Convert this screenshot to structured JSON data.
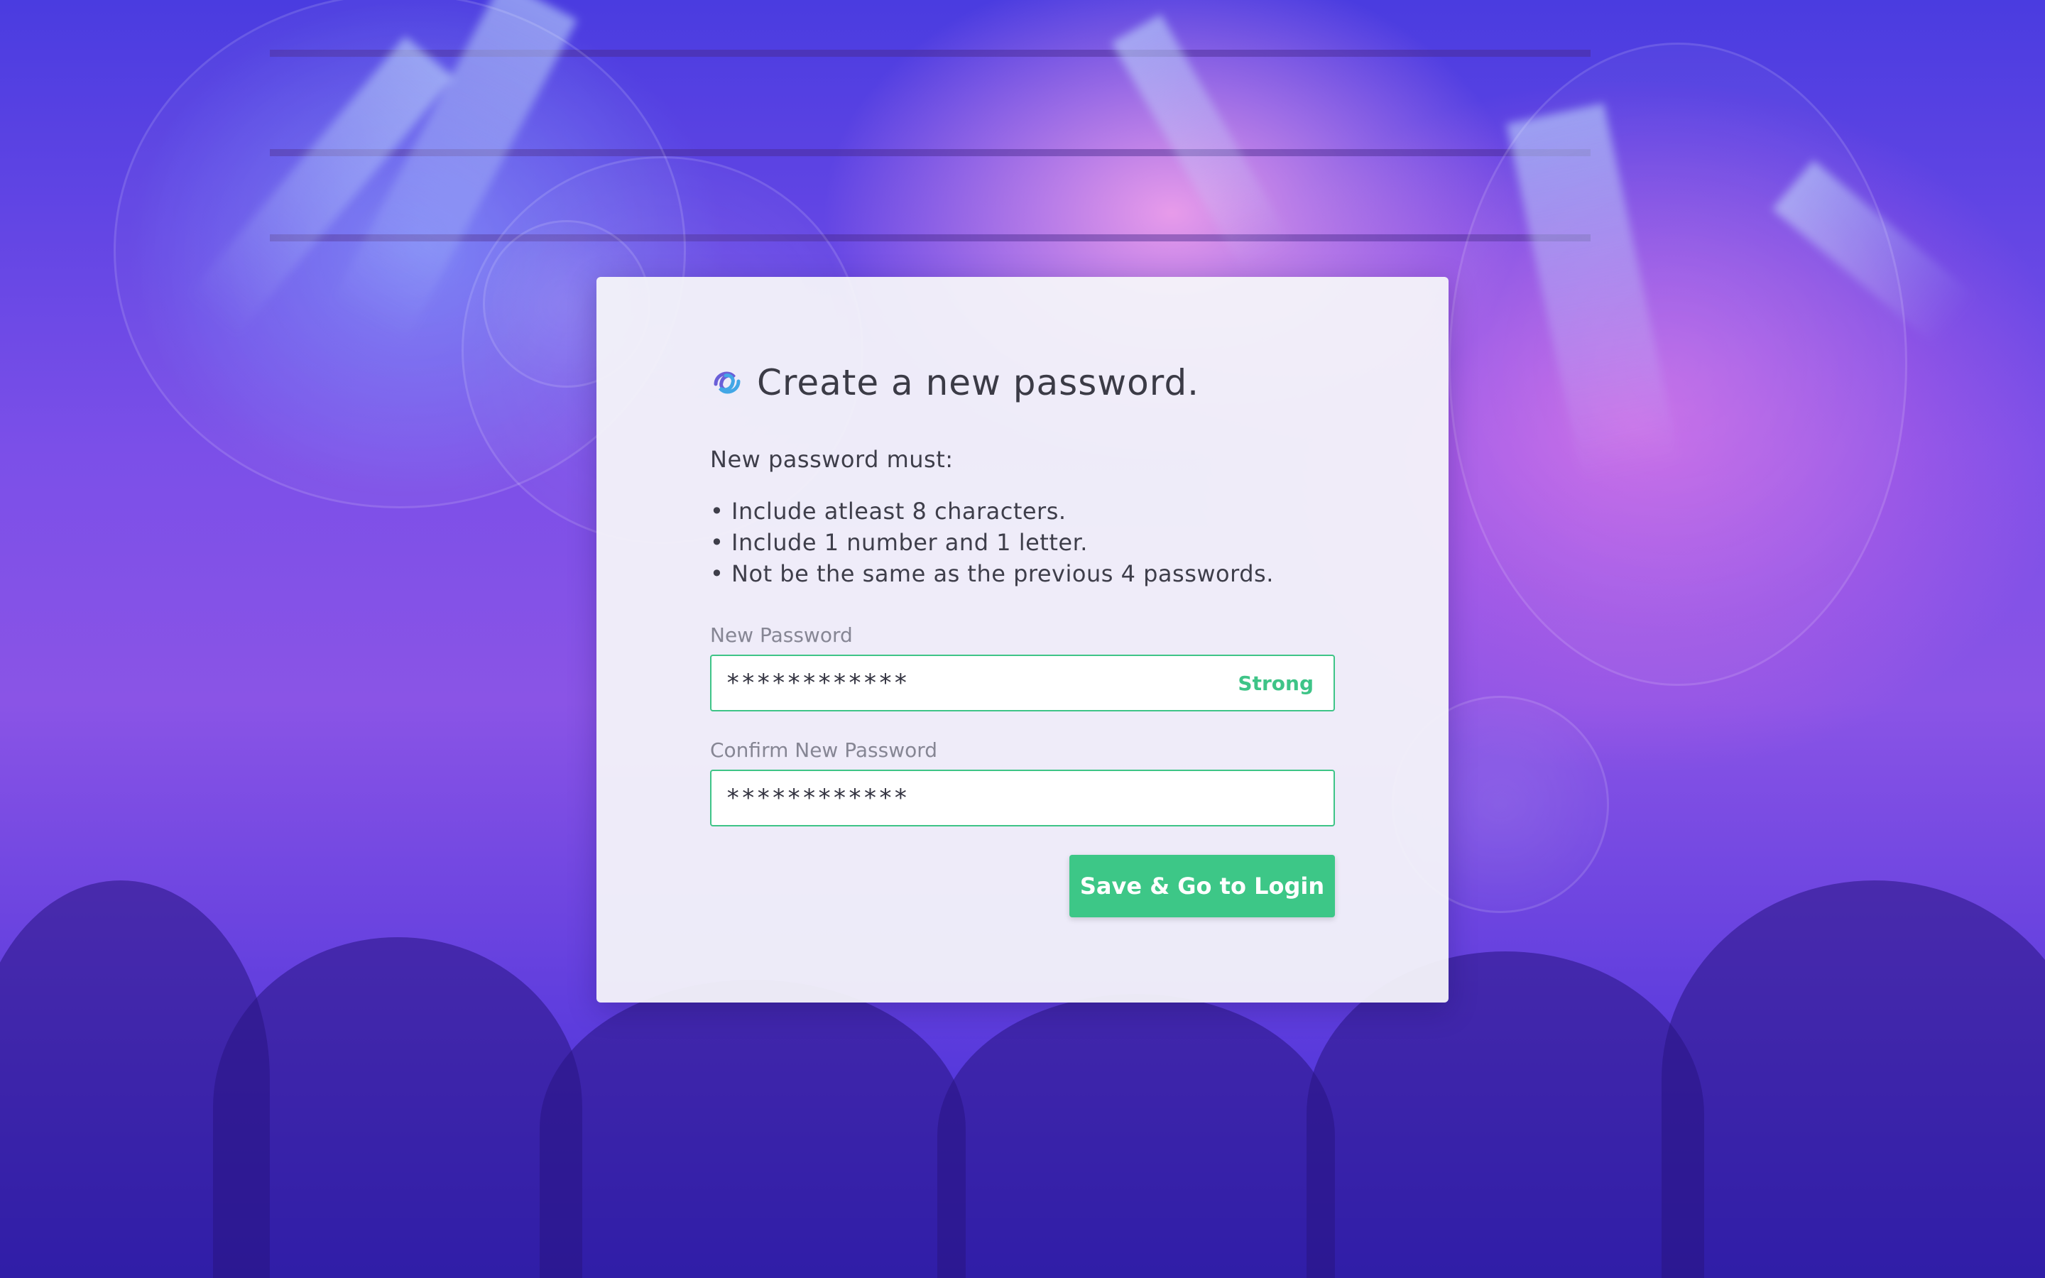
{
  "page": {
    "title": "Create a new password.",
    "intro": "New password must:",
    "rules": [
      "• Include atleast 8 characters.",
      "• Include 1 number and 1 letter.",
      "• Not be the same as the previous 4 passwords."
    ]
  },
  "form": {
    "new_password": {
      "label": "New Password",
      "value": "************",
      "strength": "Strong"
    },
    "confirm_password": {
      "label": "Confirm New Password",
      "value": "************"
    },
    "submit_label": "Save & Go to Login"
  },
  "colors": {
    "accent": "#3dc787",
    "field_border": "#3ec487",
    "text": "#3b3b46",
    "label": "#868694"
  },
  "icons": {
    "logo": "swirl-logo-icon"
  }
}
